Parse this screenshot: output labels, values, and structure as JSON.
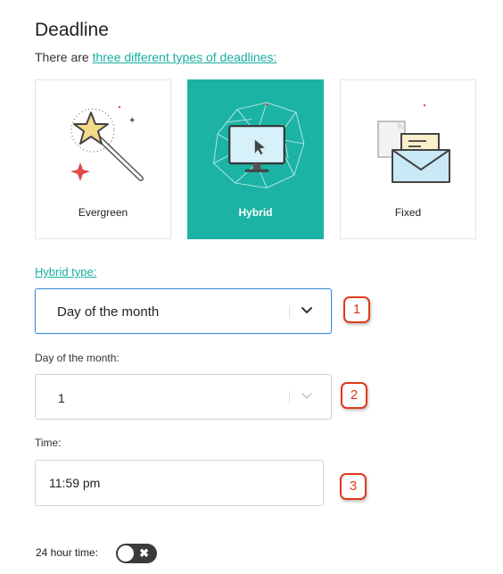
{
  "heading": "Deadline",
  "intro": {
    "text": "There are ",
    "link": "three different types of deadlines:"
  },
  "cards": [
    {
      "label": "Evergreen",
      "icon": "magic-wand-icon",
      "selected": false
    },
    {
      "label": "Hybrid",
      "icon": "monitor-network-icon",
      "selected": true
    },
    {
      "label": "Fixed",
      "icon": "envelope-icon",
      "selected": false
    }
  ],
  "hybrid_type": {
    "label": "Hybrid type:",
    "value": "Day of the month"
  },
  "day_of_month": {
    "label": "Day of the month:",
    "value": "1"
  },
  "time": {
    "label": "Time:",
    "value": "11:59 pm"
  },
  "toggle": {
    "label": "24 hour time:",
    "off_glyph": "✖"
  },
  "badges": [
    "1",
    "2",
    "3"
  ],
  "colors": {
    "accent": "#1cb3a4",
    "link": "#1aaea0",
    "focus_border": "#3d8fd8",
    "badge": "#e0391c"
  }
}
